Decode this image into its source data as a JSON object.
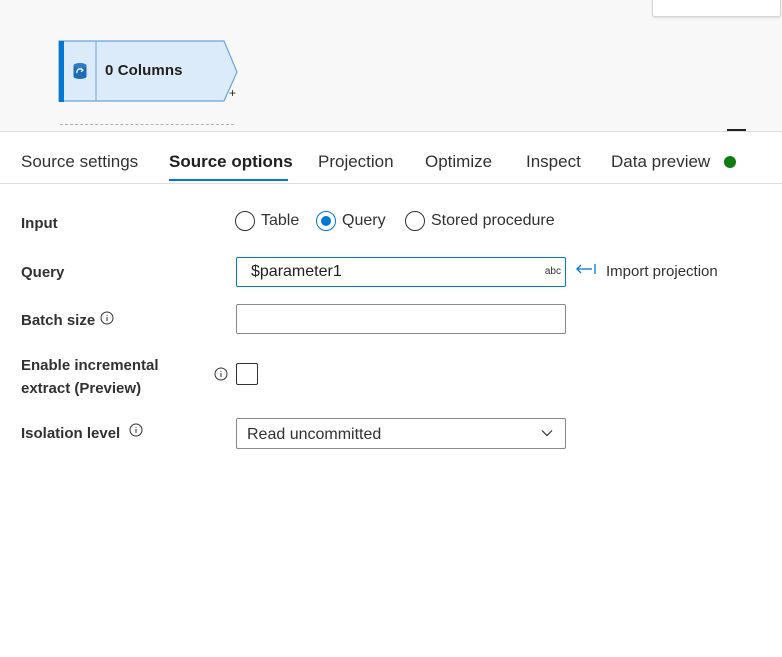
{
  "canvas": {
    "node": {
      "label": "0 Columns",
      "icon": "sql-database-icon",
      "plus": "+"
    }
  },
  "tabs": [
    {
      "label": "Source settings"
    },
    {
      "label": "Source options",
      "active": true
    },
    {
      "label": "Projection"
    },
    {
      "label": "Optimize"
    },
    {
      "label": "Inspect"
    },
    {
      "label": "Data preview",
      "status_color": "#107c10"
    }
  ],
  "form": {
    "input": {
      "label": "Input",
      "options": [
        {
          "label": "Table",
          "checked": false
        },
        {
          "label": "Query",
          "checked": true
        },
        {
          "label": "Stored procedure",
          "checked": false
        }
      ]
    },
    "query": {
      "label": "Query",
      "value": "$parameter1",
      "type_badge": "abc",
      "import_link": "Import projection"
    },
    "batch_size": {
      "label": "Batch size",
      "value": ""
    },
    "incremental": {
      "label_line1": "Enable incremental",
      "label_line2": "extract (Preview)",
      "checked": false
    },
    "isolation": {
      "label": "Isolation level",
      "value": "Read uncommitted"
    }
  },
  "colors": {
    "accent": "#0078d4",
    "status_ok": "#107c10"
  }
}
